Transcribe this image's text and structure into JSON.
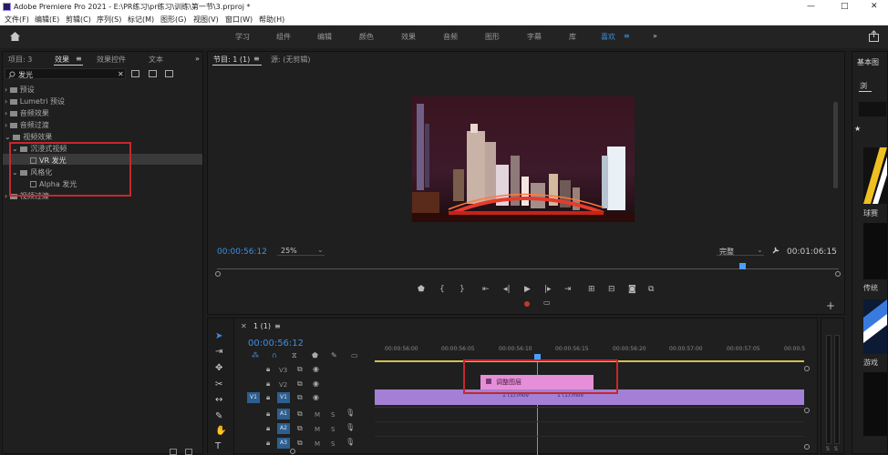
{
  "window": {
    "title": "Adobe Premiere Pro 2021 - E:\\PR练习\\pr练习\\训练\\第一节\\3.prproj *",
    "min": "—",
    "max": "□",
    "close": "✕"
  },
  "menu": [
    "文件(F)",
    "编辑(E)",
    "剪辑(C)",
    "序列(S)",
    "标记(M)",
    "图形(G)",
    "视图(V)",
    "窗口(W)",
    "帮助(H)"
  ],
  "workspaces": [
    "学习",
    "组件",
    "编辑",
    "颜色",
    "效果",
    "音频",
    "图形",
    "字幕",
    "库",
    "喜欢"
  ],
  "workspace_menu": "≡",
  "workspace_more": "»",
  "left_panel": {
    "tabs": [
      "项目: 3",
      "效果",
      "≡",
      "效果控件",
      "文本"
    ],
    "more": "»",
    "search_value": "发光",
    "search_clear": "✕",
    "tree": [
      {
        "label": "预设"
      },
      {
        "label": "Lumetri 预设"
      },
      {
        "label": "音频效果"
      },
      {
        "label": "音频过渡"
      },
      {
        "label": "视频效果"
      },
      {
        "label": "沉浸式视频"
      },
      {
        "label": "VR 发光"
      },
      {
        "label": "风格化"
      },
      {
        "label": "Alpha 发光"
      },
      {
        "label": "视频过渡"
      }
    ]
  },
  "program": {
    "tab": "节目: 1 (1)",
    "tab_menu": "≡",
    "source_tab": "源: (无剪辑)",
    "timecode": "00:00:56:12",
    "zoom": "25%",
    "quality": "完整",
    "duration": "00:01:06:15",
    "add": "+"
  },
  "timeline": {
    "close": "✕",
    "tab": "1 (1)",
    "tab_menu": "≡",
    "timecode": "00:00:56:12",
    "ruler": [
      "00:00:56:00",
      "00:00:56:05",
      "00:00:56:10",
      "00:00:56:15",
      "00:00:56:20",
      "00:00:57:00",
      "00:00:57:05",
      "00:00:5"
    ],
    "tracks": {
      "v3": "V3",
      "v2": "V2",
      "v1_src": "V1",
      "v1": "V1",
      "a1": "A1",
      "a2": "A2",
      "a3": "A3",
      "m": "M",
      "s": "S"
    },
    "adjust_layer": "调整图层",
    "clip_a": "1 (1).mov",
    "clip_b": "1 (1).mov"
  },
  "right_panel": {
    "title": "基本图",
    "tab": "浏",
    "star": "★",
    "labels": [
      "球赛",
      "传统",
      "游戏"
    ]
  },
  "audio_meter": {
    "s1": "S",
    "s2": "S"
  },
  "colors": {
    "accent_blue": "#3b8fe6",
    "highlight_red": "#c6282c",
    "clip_purple": "#a47fd6",
    "adjust_pink": "#e48fd8",
    "playhead": "#4aa0ff"
  }
}
